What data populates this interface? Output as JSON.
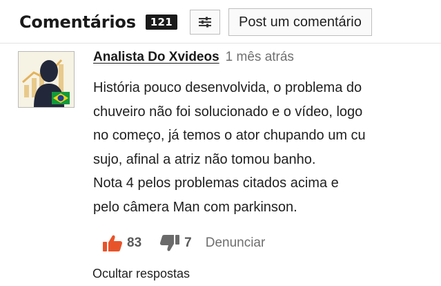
{
  "comments_section": {
    "title": "Comentários",
    "count": "121",
    "filter_icon": "sliders-icon",
    "post_button_label": "Post um comentário"
  },
  "comment": {
    "author": "Analista Do Xvideos",
    "time": "1 mês atrás",
    "avatar_icon": "user-silhouette-with-chart-and-brazil-flag",
    "lines": [
      "História pouco desenvolvida, o problema do",
      "chuveiro não foi solucionado e o vídeo, logo",
      "no começo, já temos o ator chupando um cu",
      "sujo, afinal a atriz não tomou banho.",
      "Nota 4 pelos problemas citados acima e",
      "pelo câmera Man com parkinson."
    ],
    "likes": "83",
    "dislikes": "7",
    "report_label": "Denunciar",
    "hide_replies_label": "Ocultar respostas"
  },
  "colors": {
    "like_accent": "#e8542a",
    "dislike_gray": "#6a6a6a",
    "badge_bg": "#1a1a1a"
  }
}
